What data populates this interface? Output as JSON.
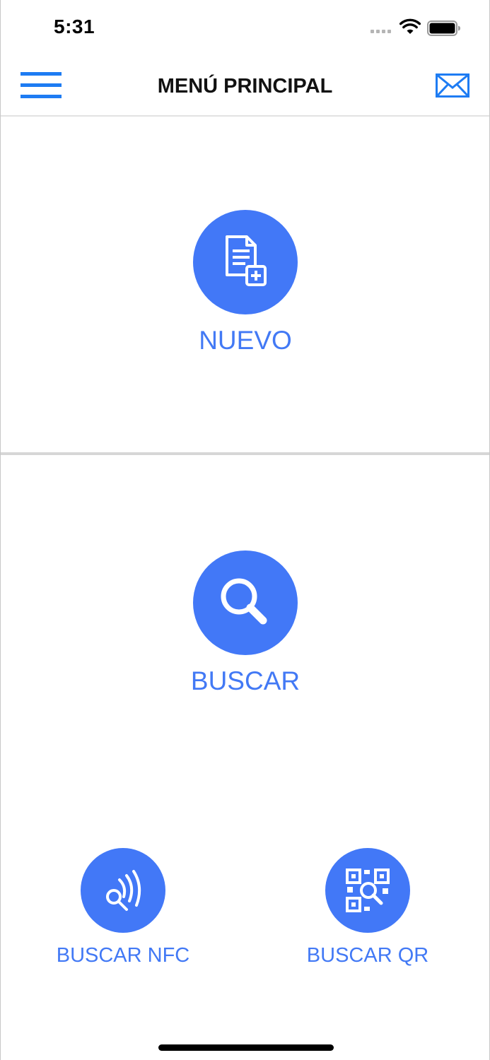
{
  "status_bar": {
    "time": "5:31"
  },
  "nav": {
    "title": "MENÚ PRINCIPAL",
    "menu_icon": "hamburger-menu-icon",
    "mail_icon": "envelope-icon"
  },
  "actions": {
    "nuevo": {
      "label": "NUEVO",
      "icon": "new-document-icon"
    },
    "buscar": {
      "label": "BUSCAR",
      "icon": "search-icon"
    },
    "buscar_nfc": {
      "label": "BUSCAR NFC",
      "icon": "nfc-search-icon"
    },
    "buscar_qr": {
      "label": "BUSCAR QR",
      "icon": "qr-search-icon"
    }
  },
  "colors": {
    "accent": "#4278f7",
    "nav_icon": "#1e7cf3",
    "label": "#4279f5"
  }
}
